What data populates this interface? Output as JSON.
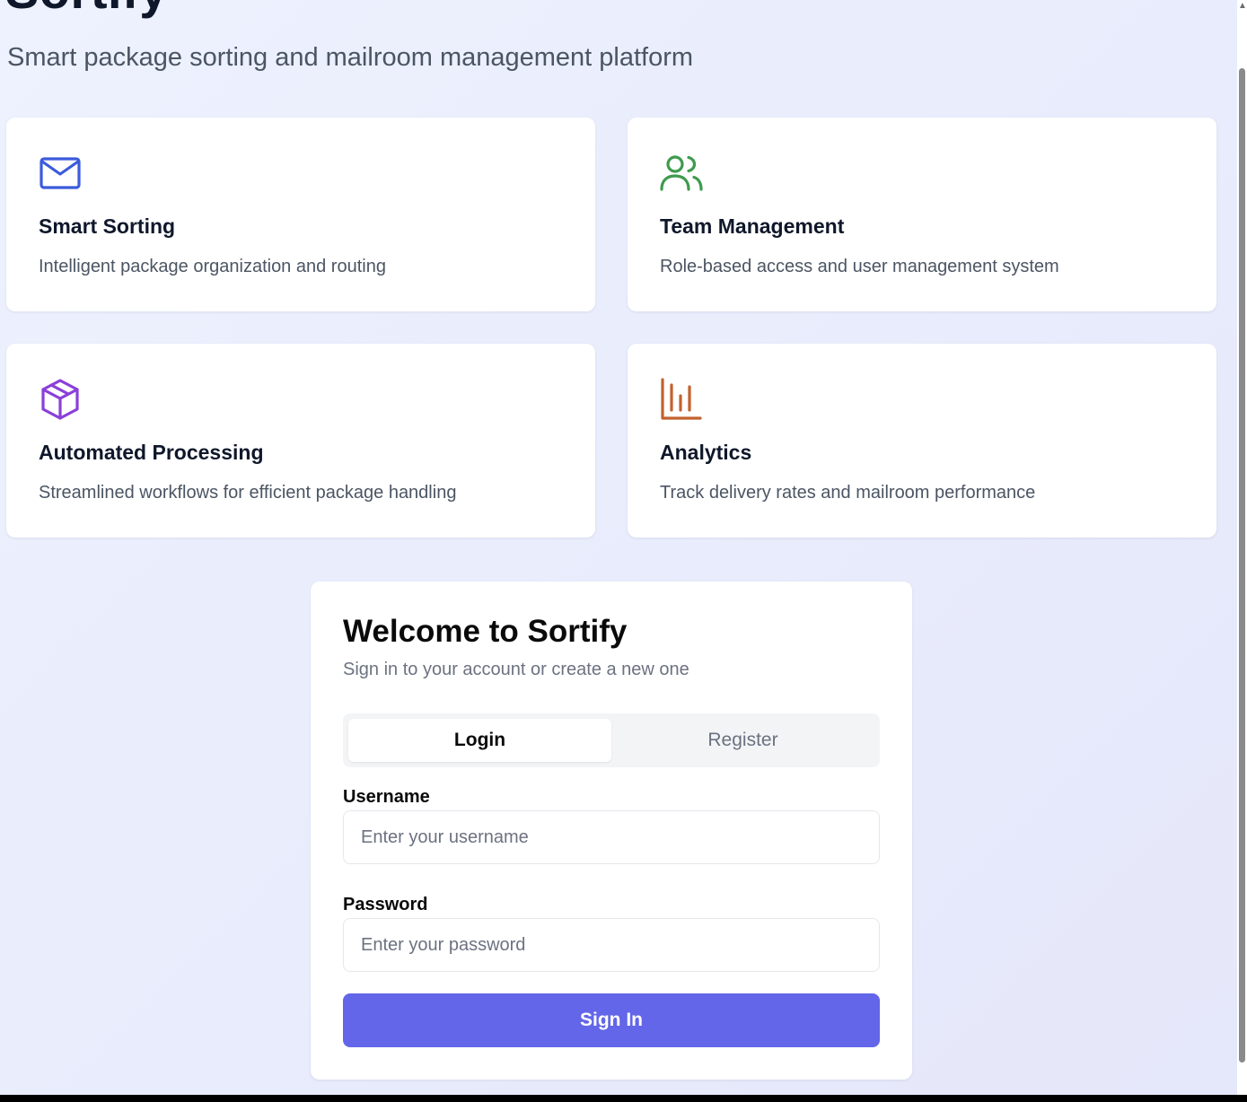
{
  "header": {
    "title": "Sortify",
    "subtitle": "Smart package sorting and mailroom management platform"
  },
  "features": [
    {
      "icon": "mail-icon",
      "color": "#3b5bdb",
      "title": "Smart Sorting",
      "description": "Intelligent package organization and routing"
    },
    {
      "icon": "users-icon",
      "color": "#3f9a4d",
      "title": "Team Management",
      "description": "Role-based access and user management system"
    },
    {
      "icon": "package-icon",
      "color": "#8b3fd9",
      "title": "Automated Processing",
      "description": "Streamlined workflows for efficient package handling"
    },
    {
      "icon": "bar-chart-icon",
      "color": "#c2622d",
      "title": "Analytics",
      "description": "Track delivery rates and mailroom performance"
    }
  ],
  "auth": {
    "title": "Welcome to Sortify",
    "subtitle": "Sign in to your account or create a new one",
    "tabs": [
      {
        "label": "Login",
        "active": true
      },
      {
        "label": "Register",
        "active": false
      }
    ],
    "username": {
      "label": "Username",
      "placeholder": "Enter your username",
      "value": ""
    },
    "password": {
      "label": "Password",
      "placeholder": "Enter your password",
      "value": ""
    },
    "submit_label": "Sign In",
    "accent_color": "#6366e8"
  }
}
